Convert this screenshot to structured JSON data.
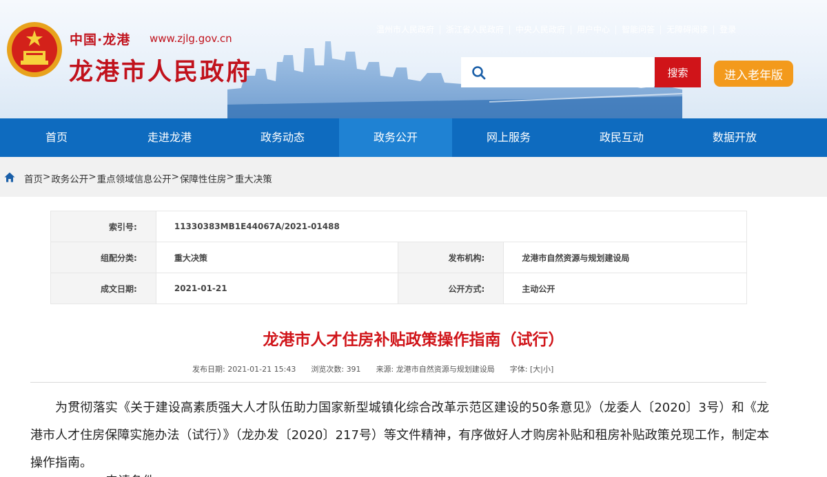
{
  "header": {
    "site_cn": "中国·龙港",
    "site_url": "www.zjlg.gov.cn",
    "site_title": "龙港市人民政府",
    "top_links": [
      "温州市人民政府",
      "浙江省人民政府",
      "中央人民政府",
      "用户中心",
      "智能问答",
      "无障碍阅读",
      "登录"
    ],
    "search_placeholder": "",
    "search_button": "搜索",
    "elder_button": "进入老年版"
  },
  "nav": {
    "items": [
      "首页",
      "走进龙港",
      "政务动态",
      "政务公开",
      "网上服务",
      "政民互动",
      "数据开放"
    ],
    "active": "政务公开"
  },
  "breadcrumb": [
    "首页",
    "政务公开",
    "重点领域信息公开",
    "保障性住房",
    "重大决策"
  ],
  "meta": {
    "index_label": "索引号:",
    "index_value": "11330383MB1E44067A/2021-01488",
    "category_label": "组配分类:",
    "category_value": "重大决策",
    "publisher_label": "发布机构:",
    "publisher_value": "龙港市自然资源与规划建设局",
    "date_label": "成文日期:",
    "date_value": "2021-01-21",
    "open_label": "公开方式:",
    "open_value": "主动公开"
  },
  "article": {
    "title": "龙港市人才住房补贴政策操作指南（试行）",
    "publish_label": "发布日期:",
    "publish_value": "2021-01-21 15:43",
    "views_label": "浏览次数:",
    "views_value": "391",
    "source_label": "来源:",
    "source_value": "龙港市自然资源与规划建设局",
    "font_label": "字体:",
    "font_open": "[",
    "font_large": "大",
    "font_sep": "|",
    "font_small": "小",
    "font_close": "]",
    "paragraph1": "为贯彻落实《关于建设高素质强大人才队伍助力国家新型城镇化综合改革示范区建设的50条意见》（龙委人〔2020〕3号）和《龙港市人才住房保障实施办法（试行）》（龙办发〔2020〕217号）等文件精神，有序做好人才购房补贴和租房补贴政策兑现工作，制定本操作指南。",
    "paragraph2": "一、申请条件"
  },
  "colors": {
    "brand_red": "#c1121c",
    "nav_blue": "#0e6bbf",
    "nav_active": "#1f82d3",
    "search_red": "#d01419",
    "elder_orange": "#f39a1c"
  },
  "icons": {
    "emblem": "national-emblem-icon",
    "search": "search-icon",
    "home": "home-icon"
  }
}
